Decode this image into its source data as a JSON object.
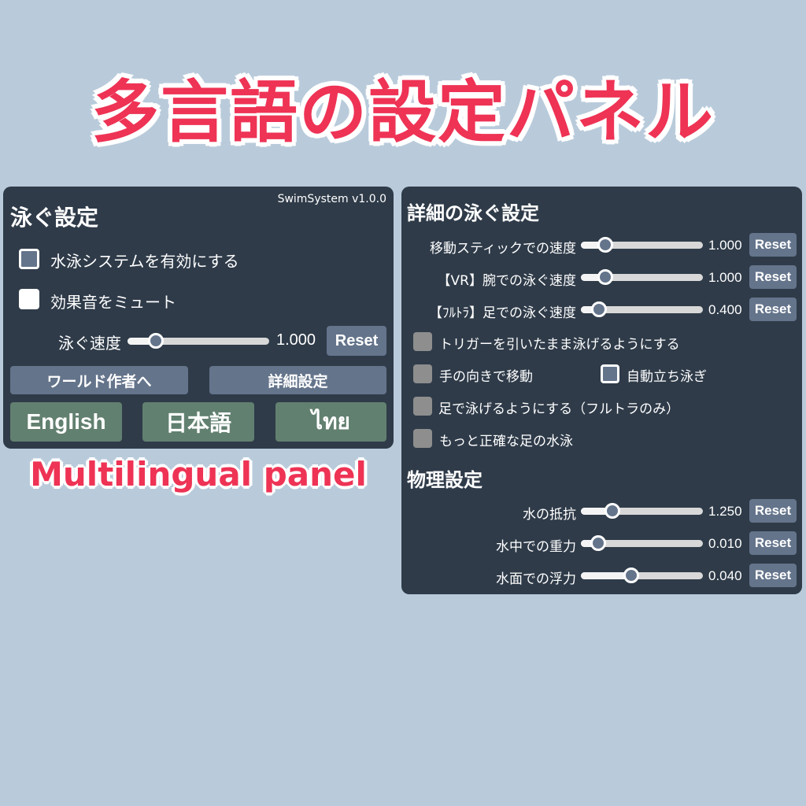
{
  "hero": {
    "title": "多言語の設定パネル",
    "subtitle": "Multilingual panel"
  },
  "colors": {
    "background": "#b9cbdb",
    "panel": "#2f3b49",
    "accent_text": "#ee3355",
    "button": "#64748b",
    "lang_button": "#628070"
  },
  "left_panel": {
    "version": "SwimSystem v1.0.0",
    "title": "泳ぐ設定",
    "checkboxes": [
      {
        "label": "水泳システムを有効にする",
        "checked": false
      },
      {
        "label": "効果音をミュート",
        "checked": true
      }
    ],
    "slider": {
      "label": "泳ぐ速度",
      "value": "1.000",
      "fraction": 0.2,
      "reset_label": "Reset"
    },
    "nav_buttons": [
      {
        "label": "ワールド作者へ"
      },
      {
        "label": "詳細設定"
      }
    ],
    "language_buttons": [
      {
        "label": "English"
      },
      {
        "label": "日本語"
      },
      {
        "label": "ไทย"
      }
    ]
  },
  "right_panel": {
    "title": "詳細の泳ぐ設定",
    "sliders": [
      {
        "label": "移動スティックでの速度",
        "value": "1.000",
        "fraction": 0.2,
        "reset_label": "Reset"
      },
      {
        "label": "【VR】腕での泳ぐ速度",
        "value": "1.000",
        "fraction": 0.2,
        "reset_label": "Reset"
      },
      {
        "label": "【ﾌﾙﾄﾗ】足での泳ぐ速度",
        "value": "0.400",
        "fraction": 0.15,
        "reset_label": "Reset"
      }
    ],
    "checkboxes": [
      {
        "label": "トリガーを引いたまま泳げるようにする",
        "checked": false
      },
      {
        "label": "手の向きで移動",
        "checked": false
      },
      {
        "label": "自動立ち泳ぎ",
        "checked": false
      },
      {
        "label": "足で泳げるようにする（フルトラのみ）",
        "checked": false
      },
      {
        "label": "もっと正確な足の水泳",
        "checked": false
      }
    ],
    "physics_title": "物理設定",
    "physics_sliders": [
      {
        "label": "水の抵抗",
        "value": "1.250",
        "fraction": 0.26,
        "reset_label": "Reset"
      },
      {
        "label": "水中での重力",
        "value": "0.010",
        "fraction": 0.14,
        "reset_label": "Reset"
      },
      {
        "label": "水面での浮力",
        "value": "0.040",
        "fraction": 0.41,
        "reset_label": "Reset"
      }
    ]
  }
}
